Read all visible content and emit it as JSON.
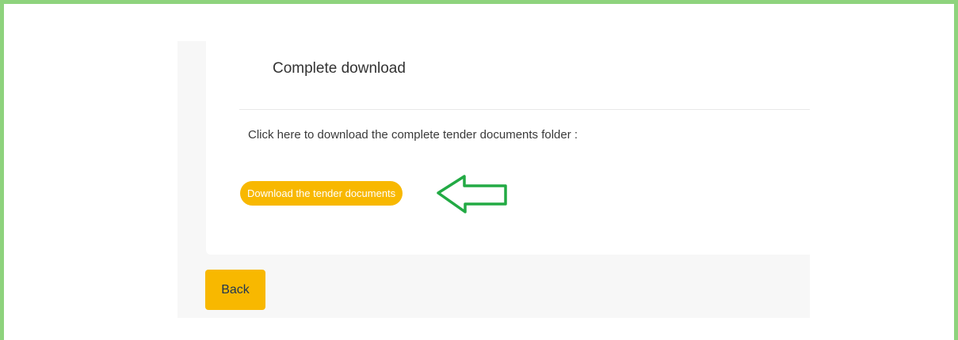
{
  "section": {
    "title": "Complete download",
    "description": "Click here to download the complete tender documents folder :",
    "download_label": "Download the tender documents"
  },
  "annotation": {
    "arrow_icon": "left-arrow-outline-icon",
    "arrow_color": "#22aa44"
  },
  "nav": {
    "back_label": "Back"
  },
  "colors": {
    "accent": "#f8b800",
    "frame_border": "#8ed37d"
  }
}
